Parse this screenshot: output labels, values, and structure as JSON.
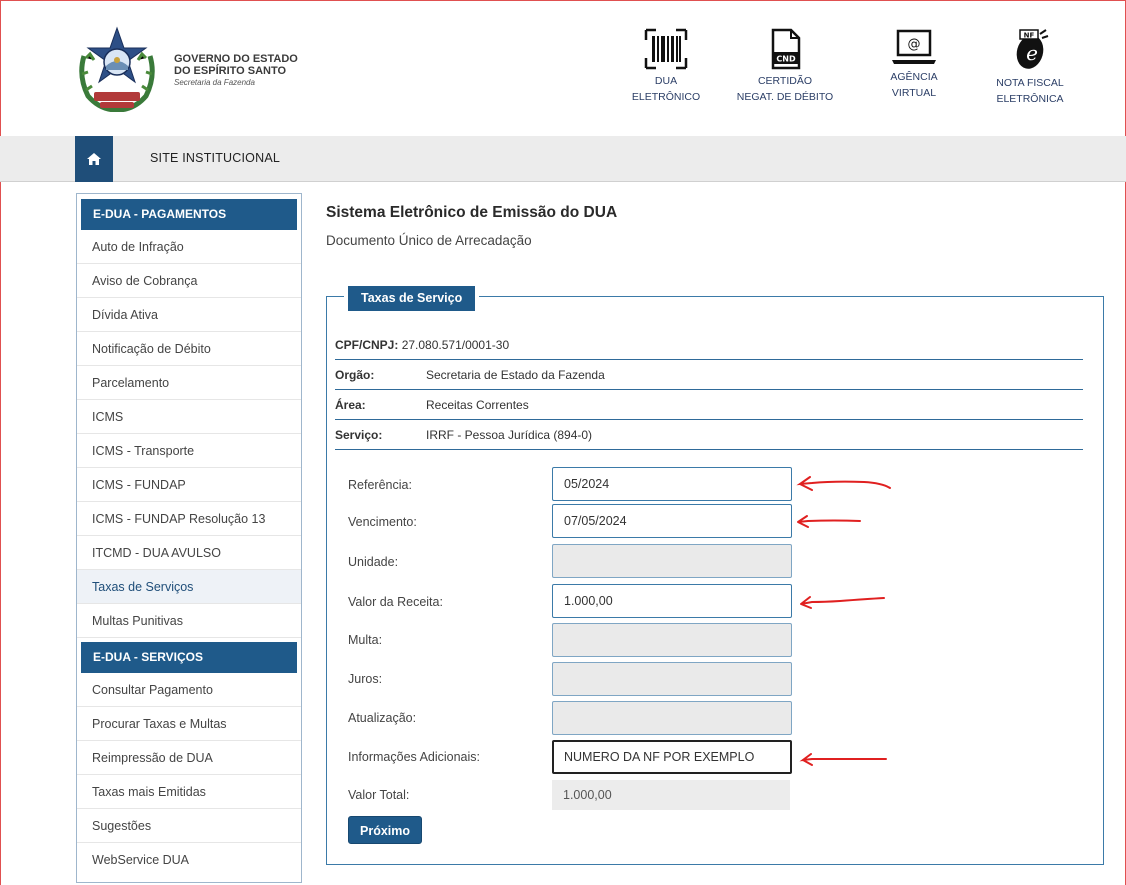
{
  "header": {
    "brand_line1": "GOVERNO DO ESTADO",
    "brand_line2": "DO ESPÍRITO SANTO",
    "brand_line3": "Secretaria da Fazenda",
    "links": [
      {
        "icon": "barcode-icon",
        "line1": "DUA",
        "line2": "ELETRÔNICO"
      },
      {
        "icon": "cnd-document-icon",
        "line1": "CERTIDÃO",
        "line2": "NEGAT. DE DÉBITO"
      },
      {
        "icon": "laptop-at-icon",
        "line1": "AGÊNCIA",
        "line2": "VIRTUAL"
      },
      {
        "icon": "nfe-icon",
        "line1": "NOTA FISCAL",
        "line2": "ELETRÔNICA"
      }
    ]
  },
  "navbar": {
    "home_icon": "home-icon",
    "link": "SITE INSTITUCIONAL"
  },
  "sidebar": {
    "section1": "E-DUA - PAGAMENTOS",
    "items1": [
      "Auto de Infração",
      "Aviso de Cobrança",
      "Dívida Ativa",
      "Notificação de Débito",
      "Parcelamento",
      "ICMS",
      "ICMS - Transporte",
      "ICMS - FUNDAP",
      "ICMS - FUNDAP Resolução 13",
      "ITCMD - DUA AVULSO",
      "Taxas de Serviços",
      "Multas Punitivas"
    ],
    "active": "Taxas de Serviços",
    "section2": "E-DUA - SERVIÇOS",
    "items2": [
      "Consultar Pagamento",
      "Procurar Taxas e Multas",
      "Reimpressão de DUA",
      "Taxas mais Emitidas",
      "Sugestões",
      "WebService DUA"
    ]
  },
  "main": {
    "title": "Sistema Eletrônico de Emissão do DUA",
    "subtitle": "Documento Único de Arrecadação",
    "legend": "Taxas de Serviço",
    "info": {
      "cpf_label": "CPF/CNPJ:",
      "cpf_value": "27.080.571/0001-30",
      "orgao_label": "Orgão:",
      "orgao_value": "Secretaria de Estado da Fazenda",
      "area_label": "Área:",
      "area_value": "Receitas Correntes",
      "servico_label": "Serviço:",
      "servico_value": "IRRF - Pessoa Jurídica (894-0)"
    },
    "form": {
      "referencia_label": "Referência:",
      "referencia_value": "05/2024",
      "vencimento_label": "Vencimento:",
      "vencimento_value": "07/05/2024",
      "unidade_label": "Unidade:",
      "unidade_value": "",
      "valor_receita_label": "Valor da Receita:",
      "valor_receita_value": "1.000,00",
      "multa_label": "Multa:",
      "multa_value": "",
      "juros_label": "Juros:",
      "juros_value": "",
      "atualizacao_label": "Atualização:",
      "atualizacao_value": "",
      "info_adicionais_label": "Informações Adicionais:",
      "info_adicionais_value": "NUMERO DA NF POR EXEMPLO",
      "valor_total_label": "Valor Total:",
      "valor_total_value": "1.000,00"
    },
    "next_button": "Próximo"
  },
  "annotations": {
    "color": "#e02020"
  }
}
